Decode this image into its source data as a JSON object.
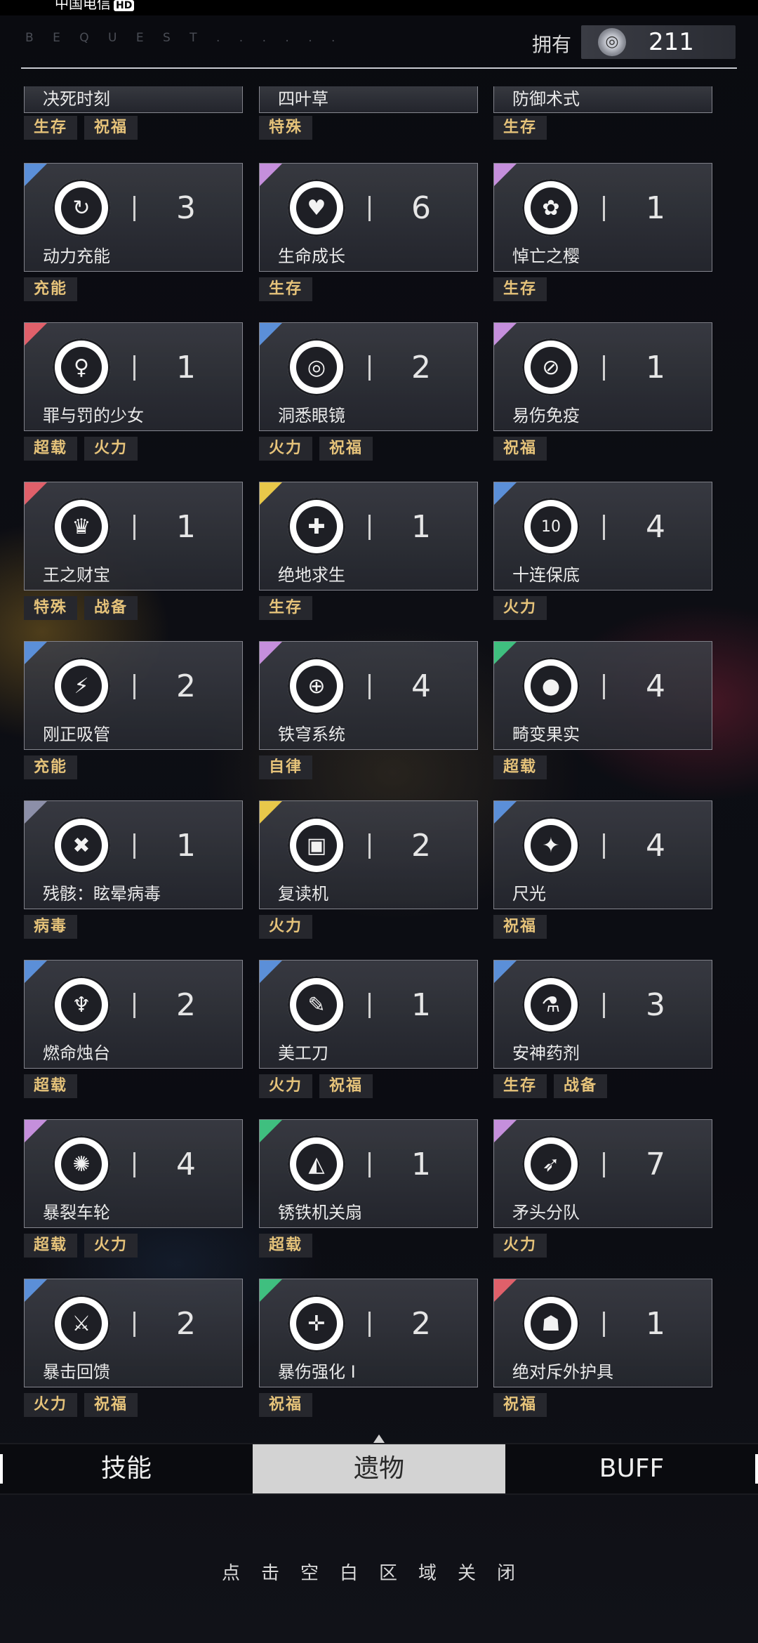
{
  "status_bar": {
    "carrier": "中国电信",
    "hd": "HD"
  },
  "header": {
    "watermark": "B E Q U E S T . . . . . .",
    "owned_label": "拥有",
    "coin_icon": "coin-icon",
    "coin_count": "211"
  },
  "colors": {
    "blue": "#5b8fd8",
    "purple": "#c58fdc",
    "red": "#e0606a",
    "gold": "#e8c84a",
    "green": "#3fbf7f",
    "gray": "#8c8fa8",
    "tag_text": "#e6c37a"
  },
  "partial_row": [
    {
      "name": "决死时刻",
      "tags": [
        "生存",
        "祝福"
      ]
    },
    {
      "name": "四叶草",
      "tags": [
        "特殊"
      ]
    },
    {
      "name": "防御术式",
      "tags": [
        "生存"
      ]
    }
  ],
  "relics": [
    {
      "name": "动力充能",
      "count": "3",
      "rarity": "blue",
      "icon": "power-charge-icon",
      "glyph": "↻",
      "tags": [
        "充能"
      ]
    },
    {
      "name": "生命成长",
      "count": "6",
      "rarity": "purple",
      "icon": "heart-icon",
      "glyph": "♥",
      "tags": [
        "生存"
      ]
    },
    {
      "name": "悼亡之樱",
      "count": "1",
      "rarity": "purple",
      "icon": "cherry-blossom-icon",
      "glyph": "✿",
      "tags": [
        "生存"
      ]
    },
    {
      "name": "罪与罚的少女",
      "count": "1",
      "rarity": "red",
      "icon": "maiden-icon",
      "glyph": "♀",
      "tags": [
        "超载",
        "火力"
      ]
    },
    {
      "name": "洞悉眼镜",
      "count": "2",
      "rarity": "blue",
      "icon": "glasses-icon",
      "glyph": "◎",
      "tags": [
        "火力",
        "祝福"
      ]
    },
    {
      "name": "易伤免疫",
      "count": "1",
      "rarity": "purple",
      "icon": "immunity-icon",
      "glyph": "⊘",
      "tags": [
        "祝福"
      ]
    },
    {
      "name": "王之财宝",
      "count": "1",
      "rarity": "red",
      "icon": "treasure-icon",
      "glyph": "♛",
      "tags": [
        "特殊",
        "战备"
      ]
    },
    {
      "name": "绝地求生",
      "count": "1",
      "rarity": "gold",
      "icon": "medkit-icon",
      "glyph": "✚",
      "tags": [
        "生存"
      ]
    },
    {
      "name": "十连保底",
      "count": "4",
      "rarity": "blue",
      "icon": "ten-pull-icon",
      "glyph": "10",
      "tags": [
        "火力"
      ]
    },
    {
      "name": "刚正吸管",
      "count": "2",
      "rarity": "blue",
      "icon": "straw-icon",
      "glyph": "⚡",
      "tags": [
        "充能"
      ]
    },
    {
      "name": "铁穹系统",
      "count": "4",
      "rarity": "purple",
      "icon": "target-icon",
      "glyph": "⊕",
      "tags": [
        "自律"
      ]
    },
    {
      "name": "畸变果实",
      "count": "4",
      "rarity": "green",
      "icon": "fruit-icon",
      "glyph": "●",
      "tags": [
        "超载"
      ]
    },
    {
      "name": "残骸：眩晕病毒",
      "count": "1",
      "rarity": "gray",
      "icon": "virus-icon",
      "glyph": "✖",
      "tags": [
        "病毒"
      ]
    },
    {
      "name": "复读机",
      "count": "2",
      "rarity": "gold",
      "icon": "recorder-icon",
      "glyph": "▣",
      "tags": [
        "火力"
      ]
    },
    {
      "name": "尺光",
      "count": "4",
      "rarity": "blue",
      "icon": "light-icon",
      "glyph": "✦",
      "tags": [
        "祝福"
      ]
    },
    {
      "name": "燃命烛台",
      "count": "2",
      "rarity": "blue",
      "icon": "candelabra-icon",
      "glyph": "♆",
      "tags": [
        "超载"
      ]
    },
    {
      "name": "美工刀",
      "count": "1",
      "rarity": "blue",
      "icon": "utility-knife-icon",
      "glyph": "✎",
      "tags": [
        "火力",
        "祝福"
      ]
    },
    {
      "name": "安神药剂",
      "count": "3",
      "rarity": "blue",
      "icon": "potion-icon",
      "glyph": "⚗",
      "tags": [
        "生存",
        "战备"
      ]
    },
    {
      "name": "暴裂车轮",
      "count": "4",
      "rarity": "purple",
      "icon": "wheel-icon",
      "glyph": "✺",
      "tags": [
        "超载",
        "火力"
      ]
    },
    {
      "name": "锈铁机关扇",
      "count": "1",
      "rarity": "green",
      "icon": "fan-icon",
      "glyph": "◭",
      "tags": [
        "超载"
      ]
    },
    {
      "name": "矛头分队",
      "count": "7",
      "rarity": "purple",
      "icon": "spearhead-icon",
      "glyph": "➶",
      "tags": [
        "火力"
      ]
    },
    {
      "name": "暴击回馈",
      "count": "2",
      "rarity": "blue",
      "icon": "crit-feedback-icon",
      "glyph": "⚔",
      "tags": [
        "火力",
        "祝福"
      ]
    },
    {
      "name": "暴伤强化 I",
      "count": "2",
      "rarity": "green",
      "icon": "crosshair-icon",
      "glyph": "✛",
      "tags": [
        "祝福"
      ]
    },
    {
      "name": "绝对斥外护具",
      "count": "1",
      "rarity": "red",
      "icon": "armor-icon",
      "glyph": "☗",
      "tags": [
        "祝福"
      ]
    }
  ],
  "tabs": {
    "skills": "技能",
    "relics": "遗物",
    "buff": "BUFF"
  },
  "close_hint": "点击空白区域关闭"
}
